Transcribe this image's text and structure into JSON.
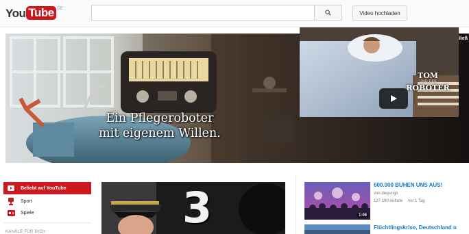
{
  "header": {
    "logo_you": "You",
    "logo_tube": "Tube",
    "logo_country": "DE",
    "search": {
      "value": "",
      "placeholder": ""
    },
    "search_button_icon": "search-icon",
    "upload_label": "Video hochladen"
  },
  "banner": {
    "close_label": "Schließ",
    "headline_line1": "Ein Pflegeroboter",
    "headline_line2": "mit eigenem Willen.",
    "video_title_line1": "TOM",
    "video_title_small": "UND DER",
    "video_title_line2": "ROBOTER",
    "play_icon": "play-icon"
  },
  "sidebar": {
    "items": [
      {
        "label": "Beliebt auf YouTube",
        "icon": "youtube-play-icon",
        "active": true
      },
      {
        "label": "Sport",
        "icon": "trophy-icon",
        "active": false
      },
      {
        "label": "Spiele",
        "icon": "gamepad-icon",
        "active": false
      }
    ],
    "heading": "KANÄLE FÜR DICH"
  },
  "main": {
    "number_overlay": "3"
  },
  "recommendations": [
    {
      "title": "600.000 BUHEN UNS AUS!",
      "channel": "von dieyungs",
      "views": "127.190 Aufrufe",
      "age": "vor 1 Tag",
      "duration": "1:06"
    },
    {
      "title": "Flüchtlingskrise, Deutschland u"
    }
  ],
  "colors": {
    "brand_red": "#cc181e",
    "link_blue": "#167ac6"
  }
}
